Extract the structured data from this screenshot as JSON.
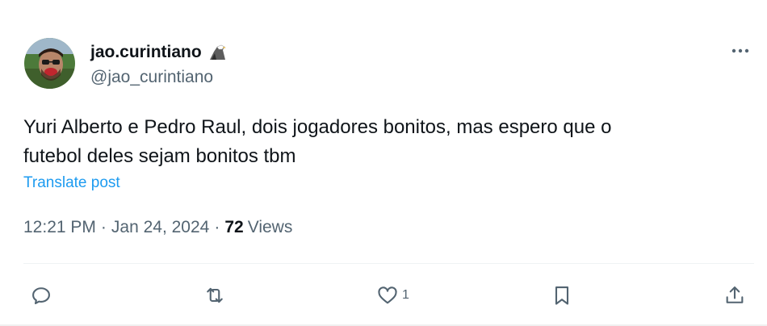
{
  "author": {
    "display_name": "jao.curintiano",
    "handle": "@jao_curintiano",
    "badge_icon": "eagle-icon",
    "avatar": "avatar-photo"
  },
  "post": {
    "text_line1": "Yuri Alberto e Pedro Raul, dois jogadores bonitos, mas espero que o",
    "text_line2": "futebol deles sejam bonitos tbm",
    "translate_label": "Translate post"
  },
  "meta": {
    "time": "12:21 PM",
    "separator": "·",
    "date": "Jan 24, 2024",
    "views_count": "72",
    "views_label": "Views"
  },
  "actions": {
    "reply_icon": "reply-icon",
    "repost_icon": "repost-icon",
    "like_icon": "heart-icon",
    "like_count": "1",
    "bookmark_icon": "bookmark-icon",
    "share_icon": "share-icon"
  },
  "colors": {
    "text": "#0f1419",
    "secondary": "#536471",
    "link": "#1d9bf0"
  }
}
